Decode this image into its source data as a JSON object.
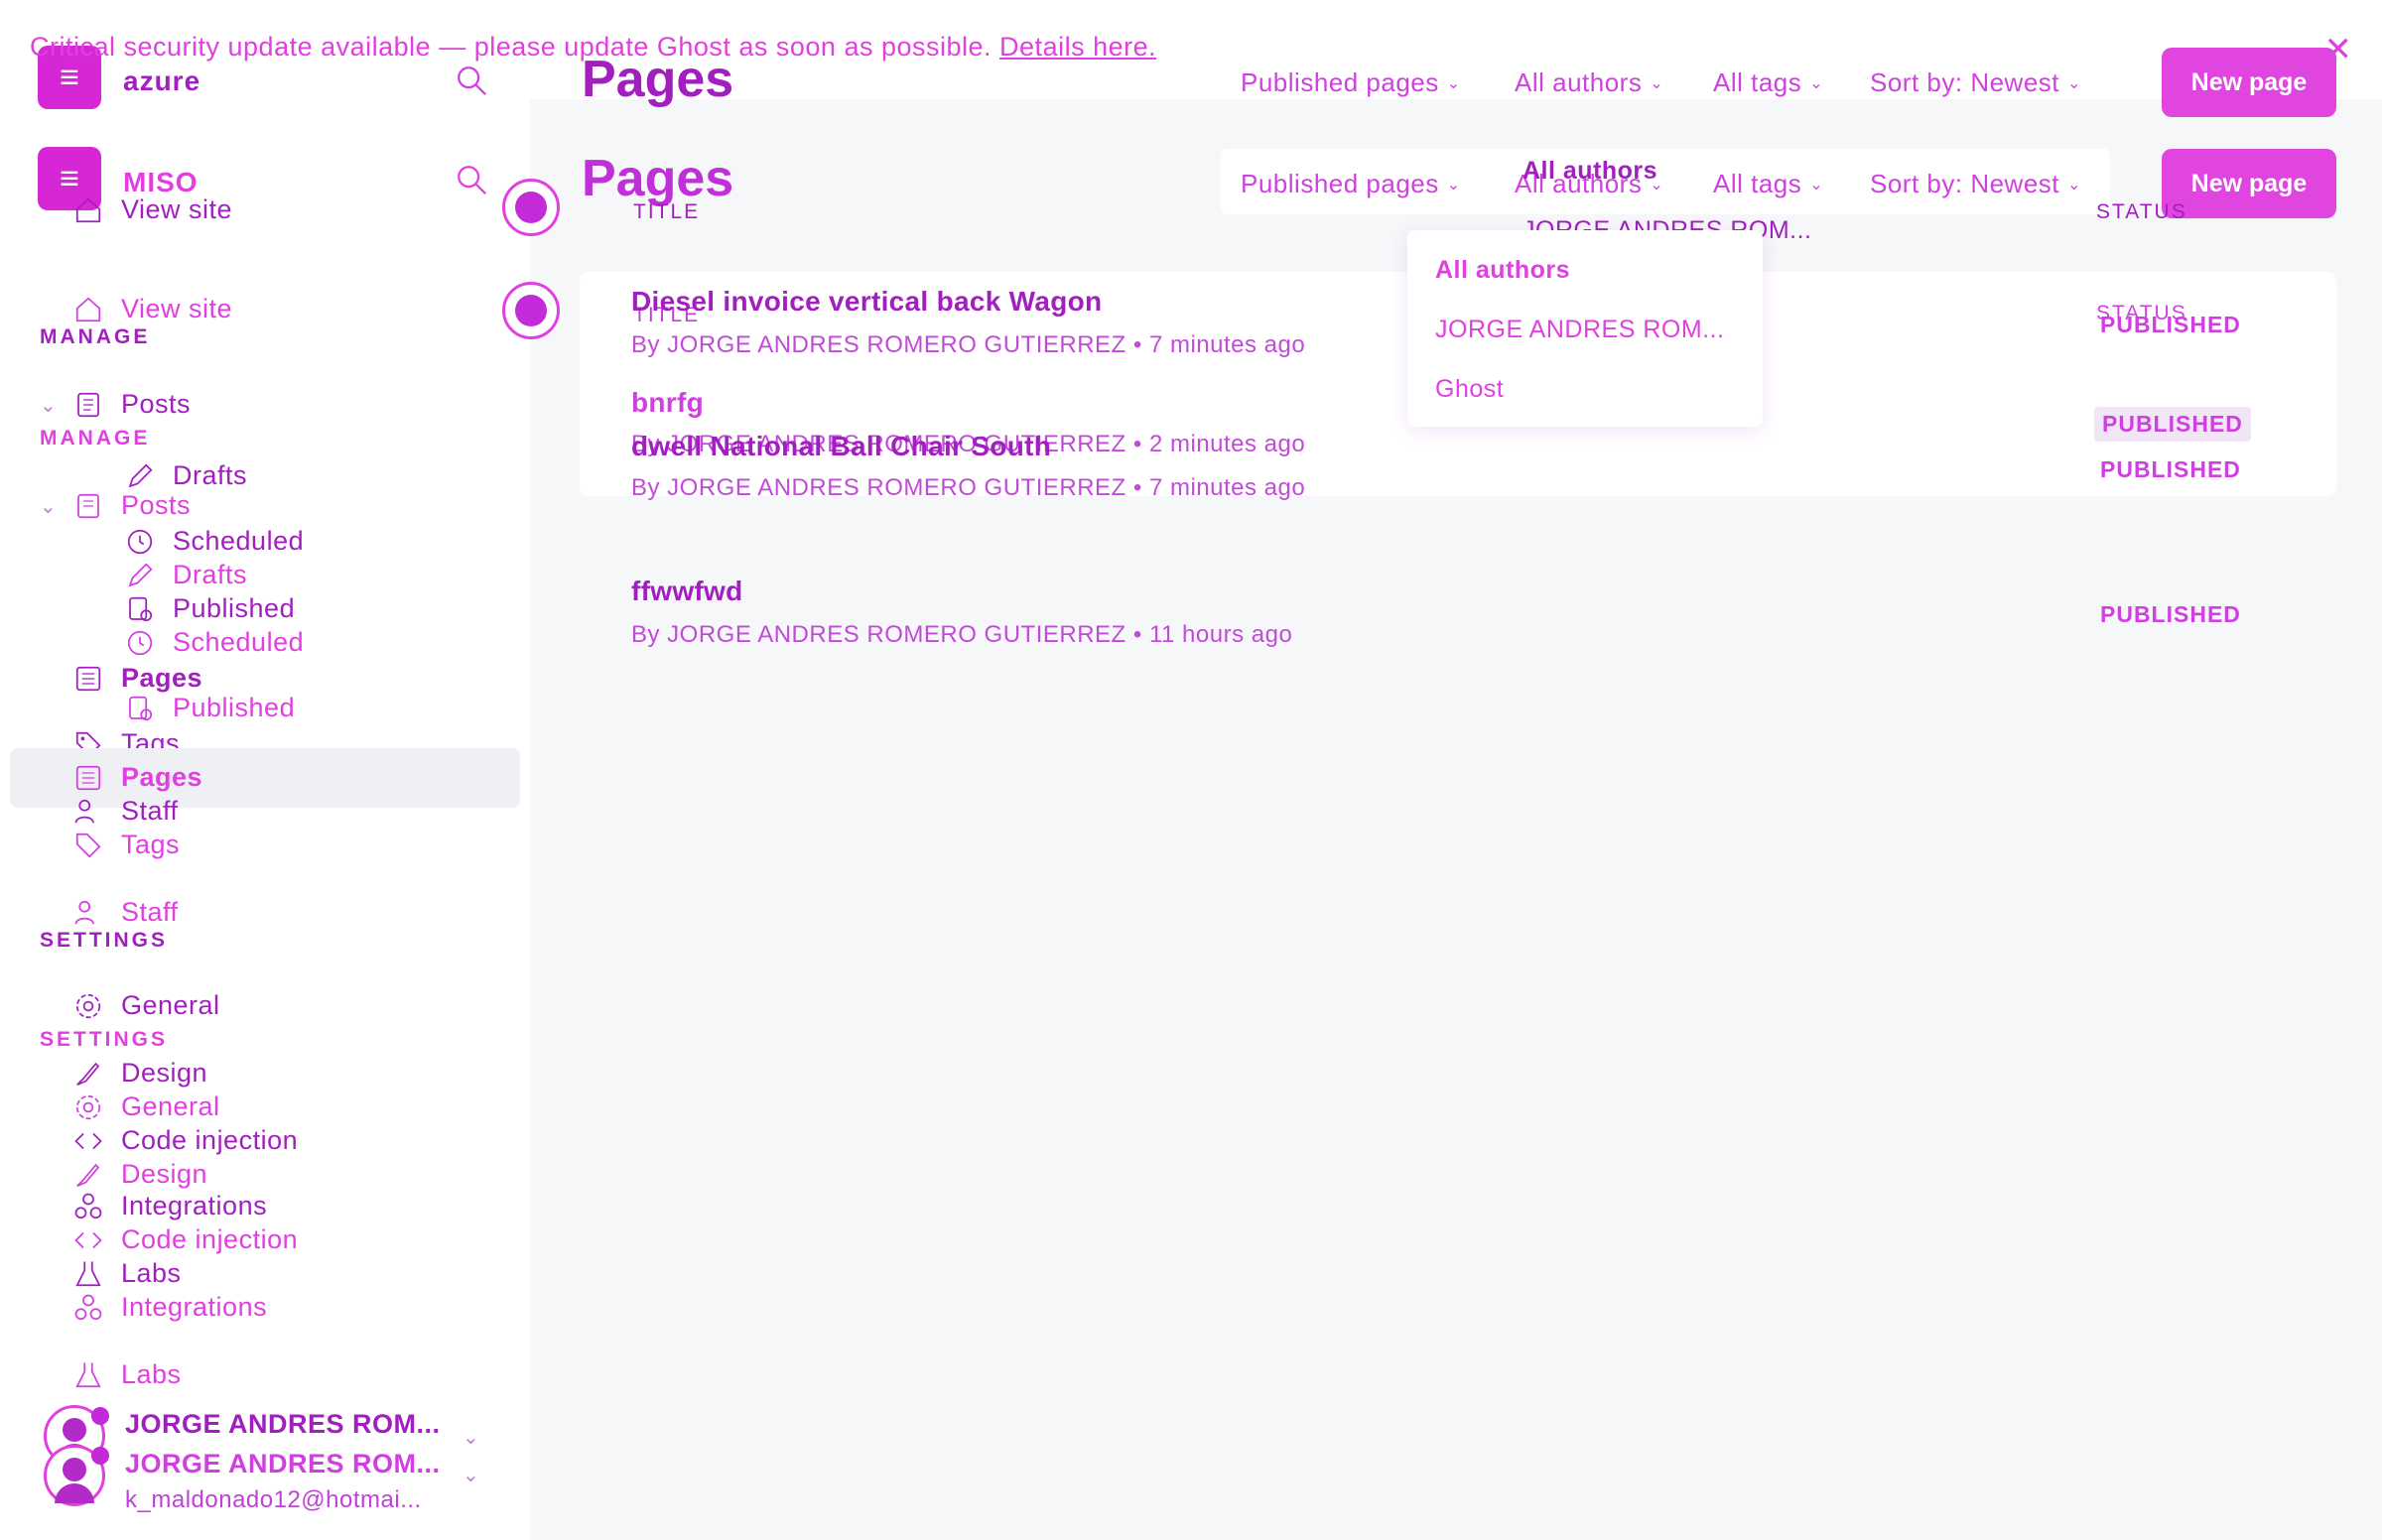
{
  "banner": {
    "text": "Critical security update available — please update Ghost as soon as possible.",
    "link": "Details here.",
    "close_icon": "close-icon"
  },
  "sidebar": {
    "site_name": "azure",
    "site_name_alt": "MISO",
    "view_site": "View site",
    "manage_label": "MANAGE",
    "settings_label": "SETTINGS",
    "items": {
      "posts": "Posts",
      "drafts": "Drafts",
      "scheduled": "Scheduled",
      "published": "Published",
      "pages": "Pages",
      "tags": "Tags",
      "staff": "Staff",
      "general": "General",
      "design": "Design",
      "code_injection": "Code injection",
      "integrations": "Integrations",
      "labs": "Labs"
    },
    "user": {
      "name": "JORGE ANDRES ROM...",
      "email": "k_maldonado12@hotmai..."
    }
  },
  "main": {
    "title": "Pages",
    "filters": {
      "type": "Published pages",
      "authors": "All authors",
      "tags": "All tags",
      "sort": "Sort by: Newest"
    },
    "new_page": "New page",
    "columns": {
      "title": "TITLE",
      "status": "STATUS"
    },
    "rows": [
      {
        "title": "Diesel invoice vertical back Wagon",
        "meta": "By JORGE ANDRES ROMERO GUTIERREZ • 7 minutes ago",
        "status": "PUBLISHED"
      },
      {
        "title": "bnrfg",
        "meta": "By JORGE ANDRES ROMERO GUTIERREZ • 2 minutes ago",
        "status": "PUBLISHED"
      },
      {
        "title": "dwell National Ball Chair South",
        "meta": "By JORGE ANDRES ROMERO GUTIERREZ • 7 minutes ago",
        "status": "PUBLISHED"
      },
      {
        "title": "ffwwfwd",
        "meta": "By JORGE ANDRES ROMERO GUTIERREZ • 11 hours ago",
        "status": "PUBLISHED"
      }
    ]
  },
  "authors_dropdown": {
    "options": [
      "All authors",
      "JORGE ANDRES ROM...",
      "Ghost"
    ],
    "selected": "All authors"
  },
  "colors": {
    "accent": "#e040e0",
    "text": "#a21fbf",
    "main_bg": "#f6f7f9"
  }
}
